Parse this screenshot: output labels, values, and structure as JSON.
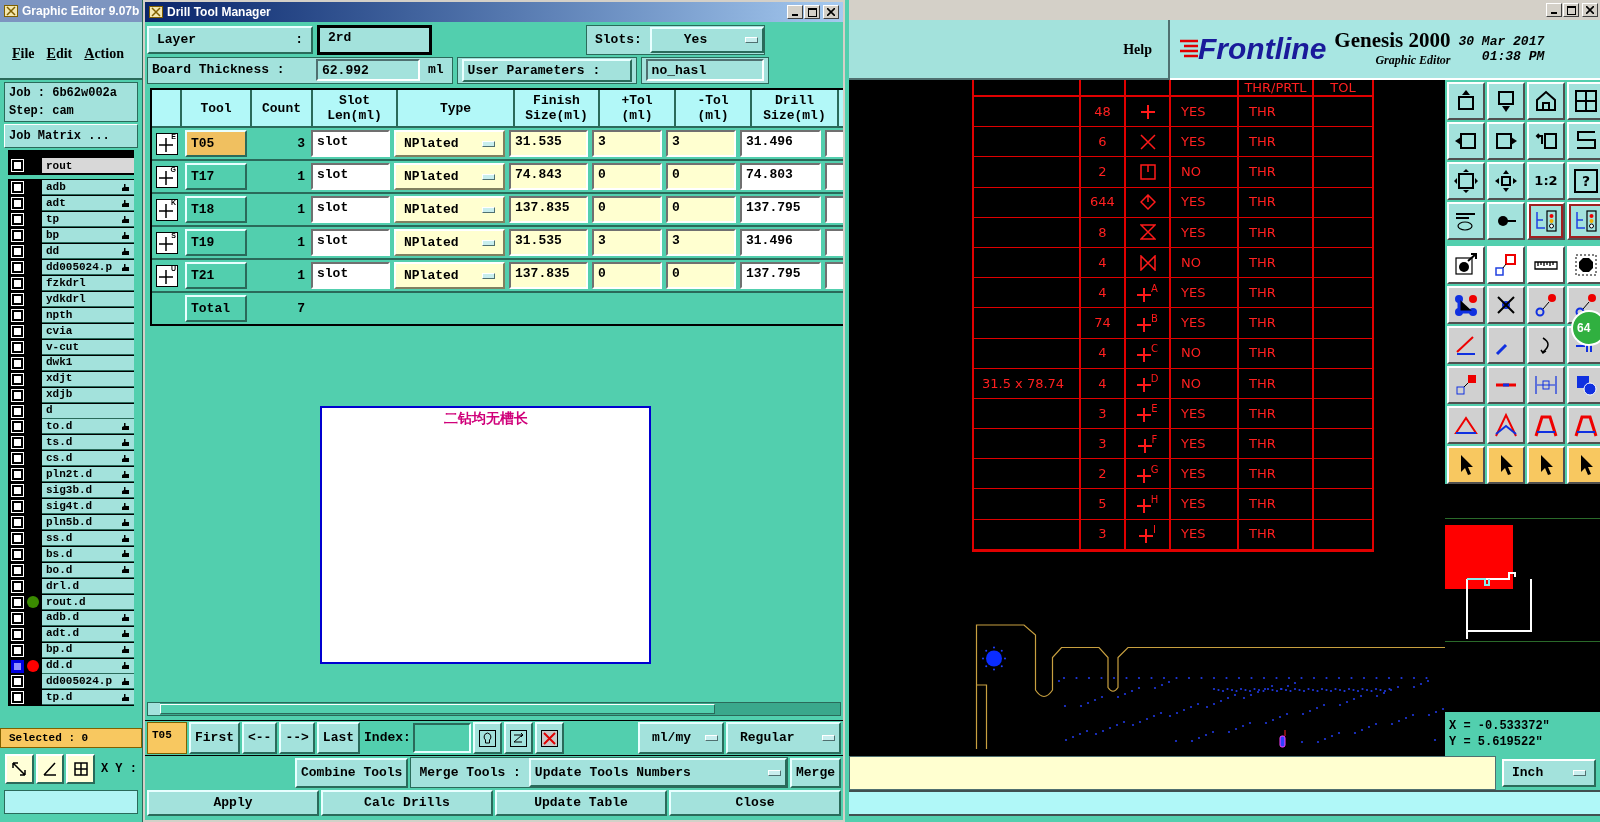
{
  "main_window": {
    "title": "Graphic Editor 9.07b",
    "menu": [
      "File",
      "Edit",
      "Action"
    ],
    "job": "Job : 6b62w002a",
    "step": "Step: cam",
    "job_matrix": "Job Matrix ...",
    "top_layer": {
      "name": "rout",
      "selected": false
    },
    "layers": [
      {
        "name": "adb",
        "affected": true,
        "selected": false
      },
      {
        "name": "adt",
        "affected": true,
        "selected": false
      },
      {
        "name": "tp",
        "affected": true,
        "selected": false
      },
      {
        "name": "bp",
        "affected": true,
        "selected": false
      },
      {
        "name": "dd",
        "affected": true,
        "selected": false
      },
      {
        "name": "dd005024.p",
        "affected": true,
        "selected": false
      },
      {
        "name": "fzkdrl",
        "affected": false,
        "selected": false
      },
      {
        "name": "ydkdrl",
        "affected": false,
        "selected": false
      },
      {
        "name": "npth",
        "affected": false,
        "selected": false
      },
      {
        "name": "cvia",
        "affected": false,
        "selected": false
      },
      {
        "name": "v-cut",
        "affected": false,
        "selected": false
      },
      {
        "name": "dwk1",
        "affected": false,
        "selected": false
      },
      {
        "name": "xdjt",
        "affected": false,
        "selected": false
      },
      {
        "name": "xdjb",
        "affected": false,
        "selected": false
      },
      {
        "name": "d",
        "affected": false,
        "selected": false
      },
      {
        "name": "to.d",
        "affected": true,
        "selected": false
      },
      {
        "name": "ts.d",
        "affected": true,
        "selected": false
      },
      {
        "name": "cs.d",
        "affected": true,
        "selected": false
      },
      {
        "name": "pln2t.d",
        "affected": true,
        "selected": false
      },
      {
        "name": "sig3b.d",
        "affected": true,
        "selected": false
      },
      {
        "name": "sig4t.d",
        "affected": true,
        "selected": false
      },
      {
        "name": "pln5b.d",
        "affected": true,
        "selected": false
      },
      {
        "name": "ss.d",
        "affected": true,
        "selected": false
      },
      {
        "name": "bs.d",
        "affected": true,
        "selected": false
      },
      {
        "name": "bo.d",
        "affected": true,
        "selected": false
      },
      {
        "name": "drl.d",
        "affected": false,
        "selected": false
      },
      {
        "name": "rout.d",
        "affected": false,
        "selected": false,
        "color": "#3a8a00"
      },
      {
        "name": "adb.d",
        "affected": true,
        "selected": false
      },
      {
        "name": "adt.d",
        "affected": true,
        "selected": false
      },
      {
        "name": "bp.d",
        "affected": true,
        "selected": false
      },
      {
        "name": "dd.d",
        "affected": true,
        "selected": true,
        "color": "#ff0000"
      },
      {
        "name": "dd005024.p",
        "affected": true,
        "selected": false
      },
      {
        "name": "tp.d",
        "affected": true,
        "selected": false
      }
    ],
    "selected_count": "Selected : 0",
    "xy_label": "X Y :"
  },
  "dialog": {
    "title": "Drill Tool Manager",
    "layer_label": "Layer",
    "layer_colon": ":",
    "layer_value": "2rd",
    "slots_label": "Slots:",
    "slots_value": "Yes",
    "thickness_label": "Board Thickness :",
    "thickness_value": "62.992",
    "thickness_unit": "ml",
    "user_params_label": "User Parameters :",
    "user_params_value": "no_hasl",
    "columns": [
      "Tool",
      "Count",
      "Slot Len(ml)",
      "Type",
      "Finish Size(ml)",
      "+Tol (ml)",
      "-Tol (ml)",
      "Drill Size(ml)"
    ],
    "rows": [
      {
        "symbol_letter": "E",
        "tool": "T05",
        "count": "3",
        "slot_len": "slot",
        "type": "NPlated",
        "finish": "31.535",
        "plus_tol": "3",
        "minus_tol": "3",
        "drill": "31.496",
        "selected": true
      },
      {
        "symbol_letter": "G",
        "tool": "T17",
        "count": "1",
        "slot_len": "slot",
        "type": "NPlated",
        "finish": "74.843",
        "plus_tol": "0",
        "minus_tol": "0",
        "drill": "74.803",
        "selected": false
      },
      {
        "symbol_letter": "K",
        "tool": "T18",
        "count": "1",
        "slot_len": "slot",
        "type": "NPlated",
        "finish": "137.835",
        "plus_tol": "0",
        "minus_tol": "0",
        "drill": "137.795",
        "selected": false
      },
      {
        "symbol_letter": "S",
        "tool": "T19",
        "count": "1",
        "slot_len": "slot",
        "type": "NPlated",
        "finish": "31.535",
        "plus_tol": "3",
        "minus_tol": "3",
        "drill": "31.496",
        "selected": false
      },
      {
        "symbol_letter": "U",
        "tool": "T21",
        "count": "1",
        "slot_len": "slot",
        "type": "NPlated",
        "finish": "137.835",
        "plus_tol": "0",
        "minus_tol": "0",
        "drill": "137.795",
        "selected": false
      }
    ],
    "total": {
      "label": "Total",
      "count": "7"
    },
    "note": "二钻均无槽长",
    "current_tool": "T05",
    "nav": [
      "First",
      "<--",
      "-->",
      "Last"
    ],
    "index_label": "Index:",
    "units": "ml/my",
    "mode": "Regular",
    "combine": "Combine Tools",
    "merge_label": "Merge Tools :",
    "merge_option": "Update Tools Numbers",
    "merge": "Merge",
    "actions": [
      "Apply",
      "Calc Drills",
      "Update Table",
      "Close"
    ]
  },
  "editor": {
    "help": "Help",
    "logo": "Frontline",
    "product": "Genesis 2000",
    "subtitle": "Graphic Editor",
    "date": "30 Mar 2017",
    "time": "01:38 PM",
    "drill_table": {
      "header": [
        "THR/PRTL",
        "TOL"
      ],
      "rows": [
        {
          "count": "48",
          "kind": "plus",
          "plated": "YES",
          "hole": "THR"
        },
        {
          "count": "6",
          "kind": "cross",
          "plated": "YES",
          "hole": "THR"
        },
        {
          "count": "2",
          "kind": "box",
          "plated": "NO",
          "hole": "THR"
        },
        {
          "count": "644",
          "kind": "diamond",
          "plated": "YES",
          "hole": "THR"
        },
        {
          "count": "8",
          "kind": "hourglass",
          "plated": "YES",
          "hole": "THR"
        },
        {
          "count": "4",
          "kind": "bowtie",
          "plated": "NO",
          "hole": "THR"
        },
        {
          "count": "4",
          "kind": "plus_letter",
          "letter": "A",
          "plated": "YES",
          "hole": "THR"
        },
        {
          "count": "74",
          "kind": "plus_letter",
          "letter": "B",
          "plated": "YES",
          "hole": "THR"
        },
        {
          "count": "4",
          "kind": "plus_letter",
          "letter": "C",
          "plated": "NO",
          "hole": "THR"
        },
        {
          "size": "31.5 x 78.74",
          "count": "4",
          "kind": "plus_letter",
          "letter": "D",
          "plated": "NO",
          "hole": "THR"
        },
        {
          "count": "3",
          "kind": "plus_letter",
          "letter": "E",
          "plated": "YES",
          "hole": "THR"
        },
        {
          "count": "3",
          "kind": "plus_letter",
          "letter": "F",
          "plated": "YES",
          "hole": "THR"
        },
        {
          "count": "2",
          "kind": "plus_letter",
          "letter": "G",
          "plated": "YES",
          "hole": "THR"
        },
        {
          "count": "5",
          "kind": "plus_letter",
          "letter": "H",
          "plated": "YES",
          "hole": "THR"
        },
        {
          "count": "3",
          "kind": "plus_letter",
          "letter": "I",
          "plated": "YES",
          "hole": "THR"
        }
      ]
    },
    "zoom_ratio": "1:2",
    "help_glyph": "?",
    "badge": "64",
    "x_coord": "X = -0.533372\"",
    "y_coord": "Y = 5.619522\"",
    "units": "Inch"
  }
}
